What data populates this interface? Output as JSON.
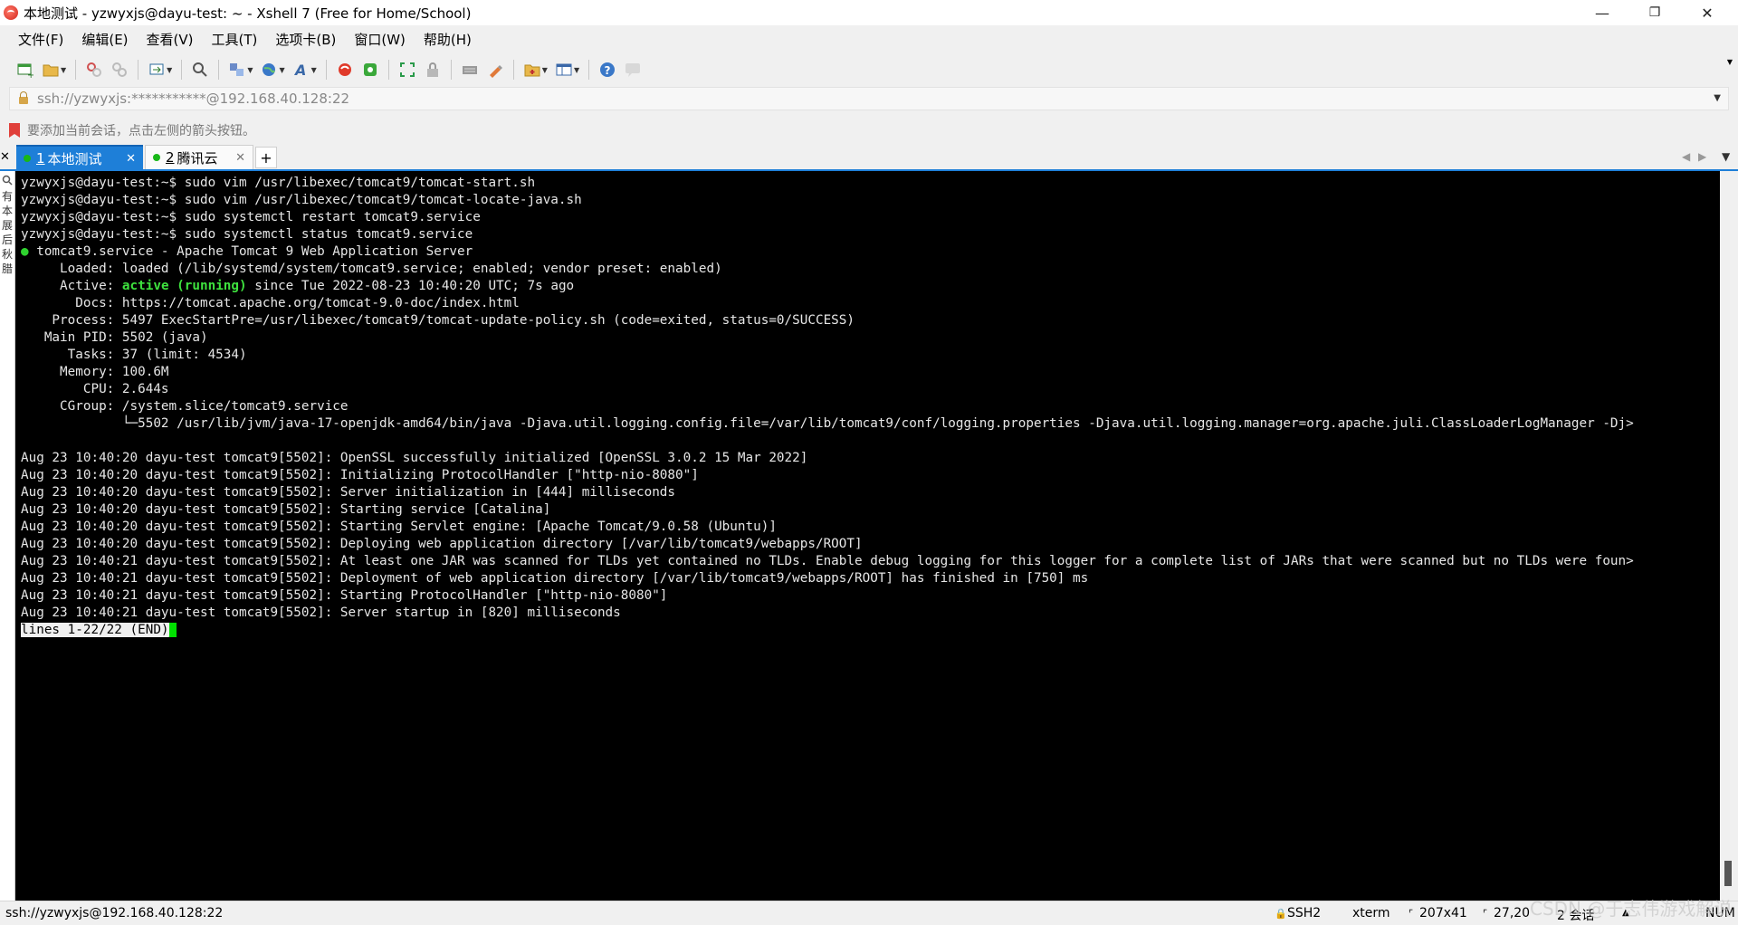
{
  "window": {
    "title": "本地测试 - yzwyxjs@dayu-test: ~ - Xshell 7 (Free for Home/School)",
    "minimize_label": "—",
    "maximize_label": "❐",
    "close_label": "✕"
  },
  "menu": [
    "文件(F)",
    "编辑(E)",
    "查看(V)",
    "工具(T)",
    "选项卡(B)",
    "窗口(W)",
    "帮助(H)"
  ],
  "address": {
    "value": "ssh://yzwyxjs:***********@192.168.40.128:22"
  },
  "hint": {
    "text": "要添加当前会话，点击左侧的箭头按钮。"
  },
  "tabs": [
    {
      "num": "1",
      "label": "本地测试",
      "active": true
    },
    {
      "num": "2",
      "label": "腾讯云",
      "active": false
    }
  ],
  "sidebar_chars": [
    "有",
    "本",
    "展",
    "后",
    "秋",
    "腊"
  ],
  "terminal": {
    "lines": [
      "yzwyxjs@dayu-test:~$ sudo vim /usr/libexec/tomcat9/tomcat-start.sh",
      "yzwyxjs@dayu-test:~$ sudo vim /usr/libexec/tomcat9/tomcat-locate-java.sh",
      "yzwyxjs@dayu-test:~$ sudo systemctl restart tomcat9.service",
      "yzwyxjs@dayu-test:~$ sudo systemctl status tomcat9.service"
    ],
    "service_line": " tomcat9.service - Apache Tomcat 9 Web Application Server",
    "loaded": "     Loaded: loaded (/lib/systemd/system/tomcat9.service; enabled; vendor preset: enabled)",
    "active_prefix": "     Active: ",
    "active_state": "active (running)",
    "active_suffix": " since Tue 2022-08-23 10:40:20 UTC; 7s ago",
    "details": [
      "       Docs: https://tomcat.apache.org/tomcat-9.0-doc/index.html",
      "    Process: 5497 ExecStartPre=/usr/libexec/tomcat9/tomcat-update-policy.sh (code=exited, status=0/SUCCESS)",
      "   Main PID: 5502 (java)",
      "      Tasks: 37 (limit: 4534)",
      "     Memory: 100.6M",
      "        CPU: 2.644s",
      "     CGroup: /system.slice/tomcat9.service",
      "             └─5502 /usr/lib/jvm/java-17-openjdk-amd64/bin/java -Djava.util.logging.config.file=/var/lib/tomcat9/conf/logging.properties -Djava.util.logging.manager=org.apache.juli.ClassLoaderLogManager -Dj>",
      ""
    ],
    "logs": [
      "Aug 23 10:40:20 dayu-test tomcat9[5502]: OpenSSL successfully initialized [OpenSSL 3.0.2 15 Mar 2022]",
      "Aug 23 10:40:20 dayu-test tomcat9[5502]: Initializing ProtocolHandler [\"http-nio-8080\"]",
      "Aug 23 10:40:20 dayu-test tomcat9[5502]: Server initialization in [444] milliseconds",
      "Aug 23 10:40:20 dayu-test tomcat9[5502]: Starting service [Catalina]",
      "Aug 23 10:40:20 dayu-test tomcat9[5502]: Starting Servlet engine: [Apache Tomcat/9.0.58 (Ubuntu)]",
      "Aug 23 10:40:20 dayu-test tomcat9[5502]: Deploying web application directory [/var/lib/tomcat9/webapps/ROOT]",
      "Aug 23 10:40:21 dayu-test tomcat9[5502]: At least one JAR was scanned for TLDs yet contained no TLDs. Enable debug logging for this logger for a complete list of JARs that were scanned but no TLDs were foun>",
      "Aug 23 10:40:21 dayu-test tomcat9[5502]: Deployment of web application directory [/var/lib/tomcat9/webapps/ROOT] has finished in [750] ms",
      "Aug 23 10:40:21 dayu-test tomcat9[5502]: Starting ProtocolHandler [\"http-nio-8080\"]",
      "Aug 23 10:40:21 dayu-test tomcat9[5502]: Server startup in [820] milliseconds"
    ],
    "pager_status": "lines 1-22/22 (END)"
  },
  "status": {
    "connection": "ssh://yzwyxjs@192.168.40.128:22",
    "protocol": "SSH2",
    "term": "xterm",
    "size": "207x41",
    "position": "27,20",
    "sessions": "2 会话",
    "mode": "NUM"
  },
  "watermark": "CSDN @于志伟游戏解说",
  "colors": {
    "tab_active": "#1e7fd8",
    "terminal_bg": "#000000",
    "prompt_green": "#2fd22f"
  }
}
